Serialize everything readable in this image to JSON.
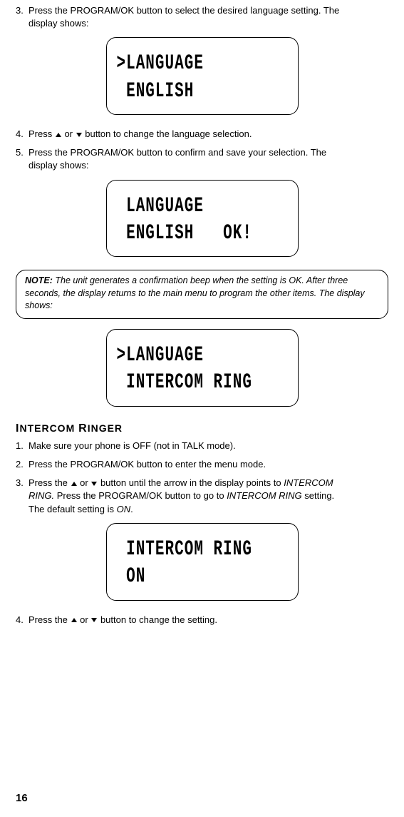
{
  "step3": {
    "num": "3.",
    "text_a": "Press the PROGRAM/OK button to select the desired language setting. The",
    "text_b": "display shows:"
  },
  "disp1": {
    "l1": ">LANGUAGE",
    "l2": " ENGLISH"
  },
  "step4": {
    "num": "4.",
    "text_a": "Press ",
    "text_mid": " or ",
    "text_b": " button to change the language selection."
  },
  "step5": {
    "num": "5.",
    "text_a": "Press the PROGRAM/OK button to confirm and save your selection. The",
    "text_b": "display shows:"
  },
  "disp2": {
    "l1": " LANGUAGE",
    "l2": " ENGLISH   OK!"
  },
  "note": {
    "label": "NOTE:",
    "text": " The unit generates a confirmation beep when the setting is OK. After three seconds, the display returns to the main menu to program the other items. The display shows:"
  },
  "disp3": {
    "l1": ">LANGUAGE",
    "l2": " INTERCOM RING"
  },
  "section": {
    "head_a": "I",
    "head_b": "NTERCOM ",
    "head_c": "R",
    "head_d": "INGER"
  },
  "ir1": {
    "num": "1.",
    "text": "Make sure your phone is OFF (not in TALK mode)."
  },
  "ir2": {
    "num": "2.",
    "text": "Press the PROGRAM/OK button to enter the menu mode."
  },
  "ir3": {
    "num": "3.",
    "a": "Press the ",
    "mid": " or ",
    "b": " button until the arrow in the display points to ",
    "it1": "INTERCOM",
    "c": "RING.",
    "d": " Press the PROGRAM/OK button to go to ",
    "it2": "INTERCOM RING",
    "e": " setting.",
    "f": "The default setting is ",
    "it3": "ON",
    "g": "."
  },
  "disp4": {
    "l1": " INTERCOM RING",
    "l2": " ON"
  },
  "ir4": {
    "num": "4.",
    "a": "Press the ",
    "mid": " or ",
    "b": " button to change the setting."
  },
  "page": "16"
}
